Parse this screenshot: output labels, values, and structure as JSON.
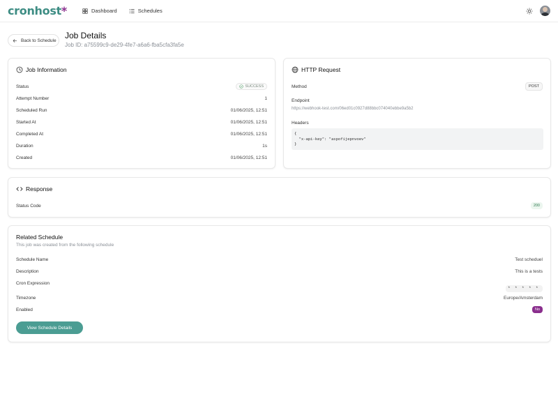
{
  "nav": {
    "logo_part1": "cronhost",
    "logo_part2": "*",
    "links": [
      {
        "label": "Dashboard",
        "icon": "dashboard-icon"
      },
      {
        "label": "Schedules",
        "icon": "list-icon"
      }
    ]
  },
  "header": {
    "back_label": "Back to Schedule",
    "title": "Job Details",
    "job_id": "Job ID: a75599c9-de29-4fe7-a6a6-fba5cfa3fa5e"
  },
  "job_info": {
    "title": "Job Information",
    "rows": [
      {
        "label": "Status",
        "value": "SUCCESS"
      },
      {
        "label": "Attempt Number",
        "value": "1"
      },
      {
        "label": "Scheduled Run",
        "value": "01/06/2025, 12:51"
      },
      {
        "label": "Started At",
        "value": "01/06/2025, 12:51"
      },
      {
        "label": "Completed At",
        "value": "01/06/2025, 12:51"
      },
      {
        "label": "Duration",
        "value": "1s"
      },
      {
        "label": "Created",
        "value": "01/06/2025, 12:51"
      }
    ]
  },
  "http_request": {
    "title": "HTTP Request",
    "method_label": "Method",
    "method_value": "POST",
    "endpoint_label": "Endpoint",
    "endpoint_value": "https://webhook-test.com/06ed01c0927d88bbc074040ebbe9a5b2",
    "headers_label": "Headers",
    "headers_value": "{\n  \"x-api-key\": \"aspofijepnvoev\"\n}"
  },
  "response": {
    "title": "Response",
    "status_label": "Status Code",
    "status_value": "200"
  },
  "related": {
    "title": "Related Schedule",
    "subtitle": "This job was created from the following schedule",
    "rows": [
      {
        "label": "Schedule Name",
        "value": "Test scheduel"
      },
      {
        "label": "Description",
        "value": "This is a tests"
      },
      {
        "label": "Cron Expression",
        "value": "* * * * *"
      },
      {
        "label": "Timezone",
        "value": "Europe/Amsterdam"
      },
      {
        "label": "Enabled",
        "value": "No"
      }
    ],
    "button_label": "View Schedule Details"
  },
  "colors": {
    "brand_teal": "#3e8d84",
    "brand_purple": "#8a2f8d",
    "button": "#4b9d93",
    "success_green": "#2f7a4f"
  }
}
